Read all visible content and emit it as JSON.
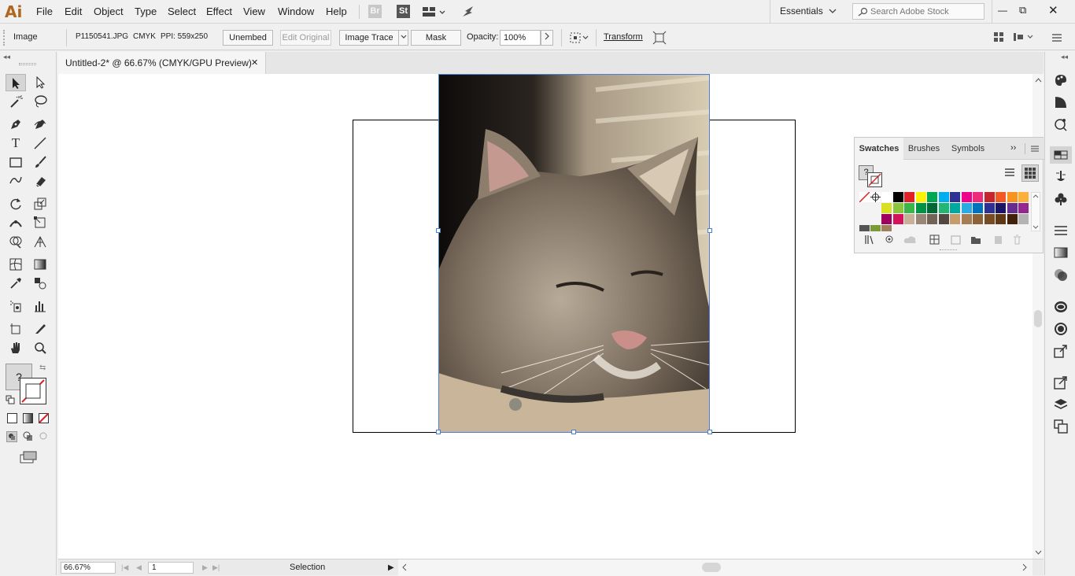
{
  "app": {
    "logo": "Ai"
  },
  "menu": {
    "items": [
      "File",
      "Edit",
      "Object",
      "Type",
      "Select",
      "Effect",
      "View",
      "Window",
      "Help"
    ]
  },
  "bridge_icon": "Br",
  "stock_icon": "St",
  "workspace": "Essentials",
  "search": {
    "placeholder": "Search Adobe Stock"
  },
  "window_controls": {
    "minimize": "—",
    "restore": "⧉",
    "close": "✕"
  },
  "control": {
    "selection_type": "Image",
    "filename": "P1150541.JPG",
    "color_mode": "CMYK",
    "ppi": "PPI: 559x250",
    "unembed": "Unembed",
    "edit_original": "Edit Original",
    "image_trace": "Image Trace",
    "mask": "Mask",
    "opacity_label": "Opacity:",
    "opacity_value": "100%",
    "transform": "Transform"
  },
  "document_tab": {
    "title": "Untitled-2* @ 66.67% (CMYK/GPU Preview)",
    "close": "✕"
  },
  "swatches_panel": {
    "tabs": [
      "Swatches",
      "Brushes",
      "Symbols"
    ],
    "rows": [
      [
        "#ffffff",
        "#000000",
        "#e11f26",
        "#fff200",
        "#00a651",
        "#00aeef",
        "#2e3192",
        "#ec008c",
        "#ee2a7b",
        "#c1272d",
        "#f15a24",
        "#f7931e",
        "#fbb03b"
      ],
      [
        "#d9e021",
        "#8cc63f",
        "#39b54a",
        "#009245",
        "#006837",
        "#22b573",
        "#00a99d",
        "#29abe2",
        "#0071bc",
        "#2e3192",
        "#1b1464",
        "#662d91",
        "#93278f"
      ],
      [
        "#9e005d",
        "#d4145a",
        "#c7b299",
        "#998675",
        "#736357",
        "#534741",
        "#c69c6d",
        "#a67c52",
        "#8c6239",
        "#754c24",
        "#603813",
        "#42210b",
        "#b3b3b3"
      ]
    ],
    "accent": "#4a90d9"
  },
  "status": {
    "zoom": "66.67%",
    "artboard": "1",
    "tool": "Selection"
  },
  "colors": {
    "selection": "#4a7fd4",
    "chrome": "#f0f0f0"
  }
}
